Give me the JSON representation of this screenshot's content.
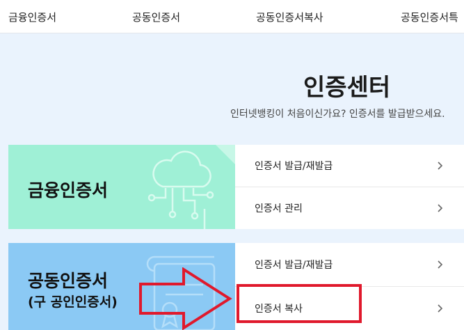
{
  "nav": {
    "tabs": [
      {
        "label": "금융인증서"
      },
      {
        "label": "공동인증서"
      },
      {
        "label": "공동인증서복사"
      },
      {
        "label": "공동인증서특"
      }
    ]
  },
  "hero": {
    "title": "인증센터",
    "subtitle": "인터넷뱅킹이 처음이신가요? 인증서를 발급받으세요."
  },
  "cards": [
    {
      "title": "금융인증서",
      "subtitle": "",
      "links": [
        {
          "label": "인증서 발급/재발급"
        },
        {
          "label": "인증서 관리"
        }
      ]
    },
    {
      "title": "공동인증서",
      "subtitle": "(구 공인인증서)",
      "links": [
        {
          "label": "인증서 발급/재발급"
        },
        {
          "label": "인증서 복사"
        }
      ]
    }
  ],
  "colors": {
    "page_bg": "#eaf3fd",
    "financial_banner": "#9ff0d6",
    "joint_banner": "#8bc9f4",
    "annotation_red": "#e0192c"
  },
  "icons": {
    "chevron": "chevron-right-icon",
    "financial_illustration": "cloud-network-icon",
    "joint_illustration": "certificate-document-icon"
  }
}
